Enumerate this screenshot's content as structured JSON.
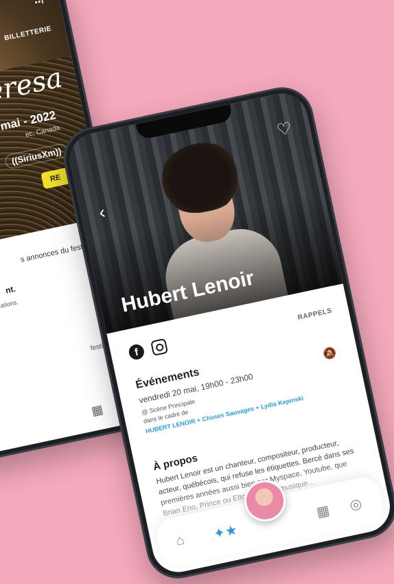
{
  "back_phone": {
    "status": "••l",
    "billetterie": "BILLETTERIE",
    "script_title": "n teresa",
    "date": "mai - 2022",
    "location": "ec, Canada",
    "sponsor": "((SiriusXm))",
    "cta": "RE",
    "notice": "s annonces du festival.",
    "notice_title": "nt.",
    "notice_sub": "notifications.",
    "festival_hint": "festival",
    "nav_icons": [
      "calendar-icon",
      "compass-icon"
    ]
  },
  "main_phone": {
    "artist_name": "Hubert Lenoir",
    "rappels": "RAPPELS",
    "events_heading": "Événements",
    "event": {
      "date": "vendredi 20 mai, 19h00 - 23h00",
      "place": "@ Scène Principale",
      "frame": "dans le cadre de",
      "link": "HUBERT LENOIR + Choses Sauvages + Lydia Kepinski"
    },
    "about_heading": "À propos",
    "bio": "Hubert Lenoir est un chanteur, compositeur, producteur, acteur, québécois, qui refuse les étiquettes. Bercé dans ses premières années aussi bien par Myspace, Youtube, que Brian Eno, Prince ou Elton John, la musique...",
    "social": [
      "facebook-icon",
      "instagram-icon"
    ],
    "tabs": [
      "home-icon",
      "stars-icon",
      "calendar-icon",
      "compass-icon"
    ]
  },
  "colors": {
    "background": "#f4a9bc",
    "link": "#2e9bd6",
    "accent_yellow": "#f4e12c"
  }
}
